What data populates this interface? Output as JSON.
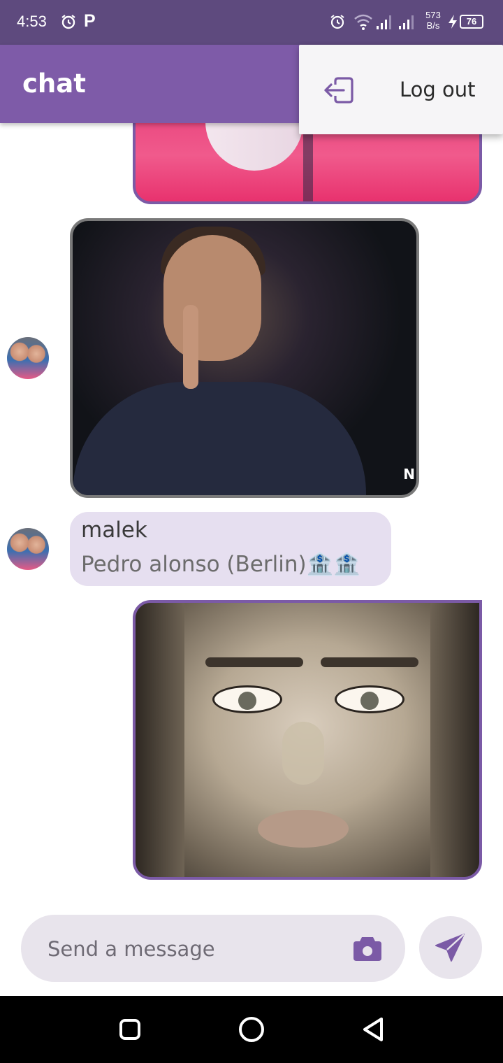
{
  "status_bar": {
    "time": "4:53",
    "p_label": "P",
    "net_speed": "573 B/s",
    "battery": "76"
  },
  "app_bar": {
    "title": "chat"
  },
  "menu": {
    "items": [
      {
        "label": "Log out",
        "icon": "logout-icon"
      }
    ]
  },
  "messages": [
    {
      "type": "image",
      "sender": "self",
      "image": "person in pink jacket (cropped)"
    },
    {
      "type": "image",
      "sender": "other",
      "image": "man in dark suit with finger on lips",
      "watermark": "N"
    },
    {
      "type": "text",
      "sender": "other",
      "name": "malek",
      "text": "Pedro alonso (Berlin)🏦🏦"
    },
    {
      "type": "image",
      "sender": "self",
      "image": "black and white portrait of a woman"
    }
  ],
  "composer": {
    "placeholder": "Send a message",
    "camera_icon": "camera-icon",
    "send_icon": "send-icon"
  },
  "colors": {
    "status_bar": "#5e4a7e",
    "app_bar": "#7e5ba8",
    "accent": "#7b5aa6",
    "bubble": "#e6dff0",
    "composer": "#e8e4ec"
  }
}
